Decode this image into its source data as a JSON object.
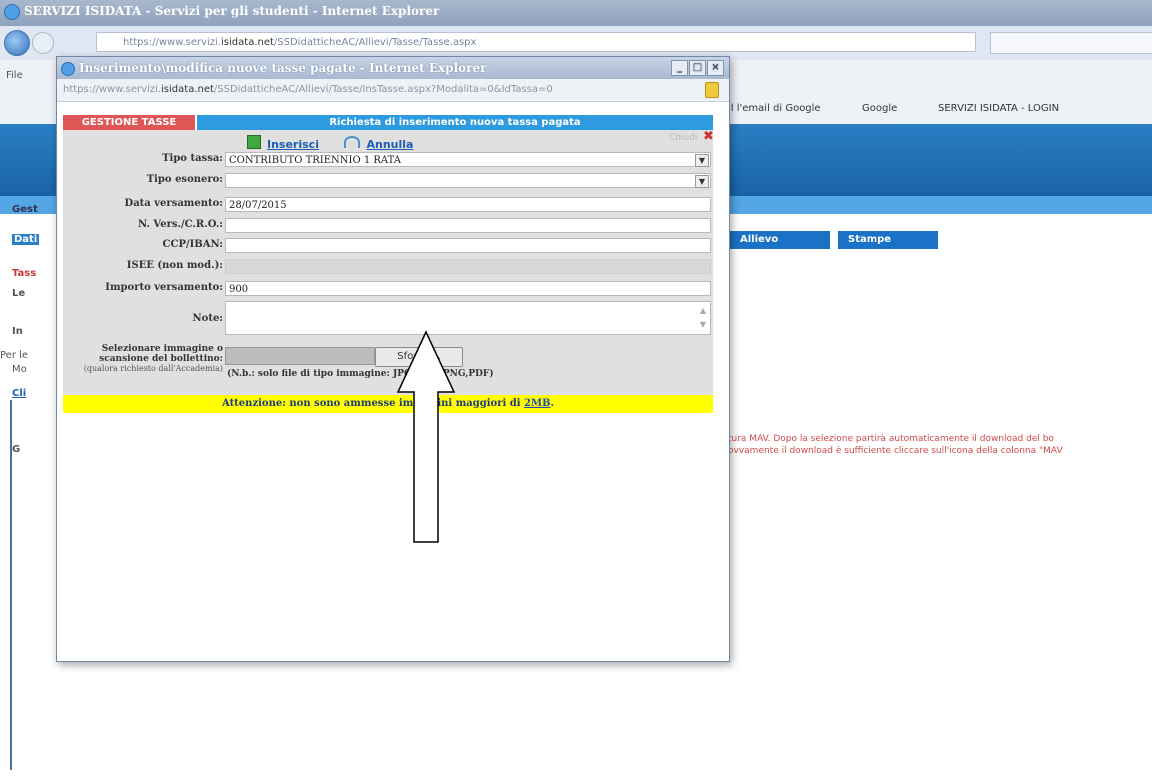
{
  "browser": {
    "title": "SERVIZI ISIDATA - Servizi per gli studenti - Internet Explorer",
    "url_prefix": "https://www.servizi.",
    "url_host": "isidata.net",
    "url_path": "/SSDidatticheAC/Allievi/Tasse/Tasse.aspx",
    "file_menu": "File",
    "favorites": [
      "il l'email di Google",
      "Google",
      "SERVIZI ISIDATA - LOGIN"
    ]
  },
  "background_page": {
    "left_items": [
      "Gest",
      "Dati",
      "Tass",
      "Le",
      "In",
      "Per le",
      "Mo",
      "Cli",
      "G"
    ],
    "nav": [
      "Allievo",
      "Stampe"
    ],
    "notice_line1": "tura MAV. Dopo la selezione partirà automaticamente il download del bo",
    "notice_line2": "ovvamente il download è sufficiente cliccare sull'icona della colonna \"MAV"
  },
  "popup": {
    "title": "Inserimento\\modifica nuove tasse pagate - Internet Explorer",
    "url_prefix": "https://www.servizi.",
    "url_host": "isidata.net",
    "url_path": "/SSDidatticheAC/Allievi/Tasse/InsTasse.aspx?Modalita=0&IdTassa=0",
    "window_buttons": [
      "_",
      "□",
      "×"
    ]
  },
  "form": {
    "section_label": "GESTIONE TASSE",
    "header": "Richiesta di inserimento nuova tassa pagata",
    "insert_label": "Inserisci",
    "cancel_label": "Annulla",
    "close_label": "Chiudi",
    "fields": [
      {
        "label": "Tipo tassa:",
        "value": "CONTRIBUTO TRIENNIO 1 RATA"
      },
      {
        "label": "Tipo esonero:",
        "value": ""
      },
      {
        "label": "Data versamento:",
        "value": "28/07/2015"
      },
      {
        "label": "N. Vers./C.R.O.:",
        "value": ""
      },
      {
        "label": "CCP/IBAN:",
        "value": ""
      },
      {
        "label": "ISEE (non mod.):",
        "value": ""
      },
      {
        "label": "Importo versamento:",
        "value": "900"
      },
      {
        "label": "Note:",
        "value": ""
      }
    ],
    "file_label": "Selezionare immagine o scansione del bollettino:",
    "file_sublabel": "(qualora richiesto dall'Accademia)",
    "browse_button": "Sfoglia...",
    "file_note": "(N.b.: solo file di tipo immagine: JPG,JPEG,PNG,PDF)",
    "warning_text": "Attenzione: non sono ammesse immagini maggiori di",
    "warning_size": "2MB",
    "warning_end": "."
  },
  "colors": {
    "header_red": "#e05555",
    "header_blue": "#2e9be0",
    "warning_yellow": "#ffff00",
    "banner_blue": "#1a62a8"
  }
}
